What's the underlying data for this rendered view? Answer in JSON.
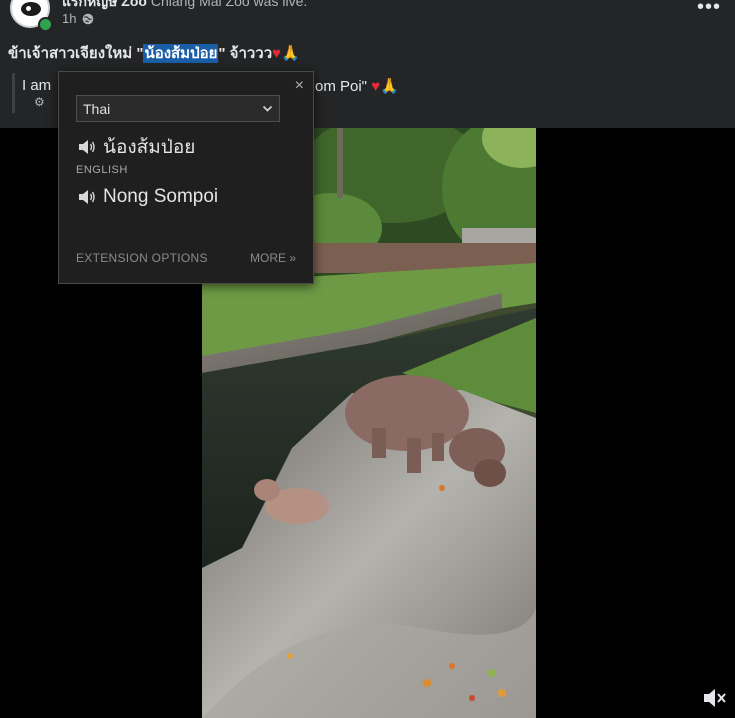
{
  "post": {
    "page_name_partial": "แรกหญ่ษ Zoo",
    "page_name_tail": " Chiang Mai Zoo",
    "page_name_trailing": " was live.",
    "time": "1h",
    "caption_before": "ข้าเจ้าสาวเจียงใหม่ \"",
    "caption_highlight": "น้องส้มป่อย",
    "caption_after": "\" จ้าววว",
    "caption_emojis": "♥🙏",
    "translation_start": "I am",
    "translation_end": "om Poi\"",
    "translation_emojis": "♥🙏"
  },
  "popup": {
    "language_select": "Thai",
    "source_text": "น้องส้มป่อย",
    "target_label": "ENGLISH",
    "target_text": "Nong Sompoi",
    "extension_options": "EXTENSION OPTIONS",
    "more": "MORE »",
    "close": "×"
  },
  "icons": {
    "more": "more-options-icon",
    "globe": "globe-icon",
    "speaker": "speaker-icon",
    "mute": "mute-icon"
  },
  "colors": {
    "highlight": "#1a5ea8",
    "online": "#31a24c",
    "background": "#242526"
  }
}
